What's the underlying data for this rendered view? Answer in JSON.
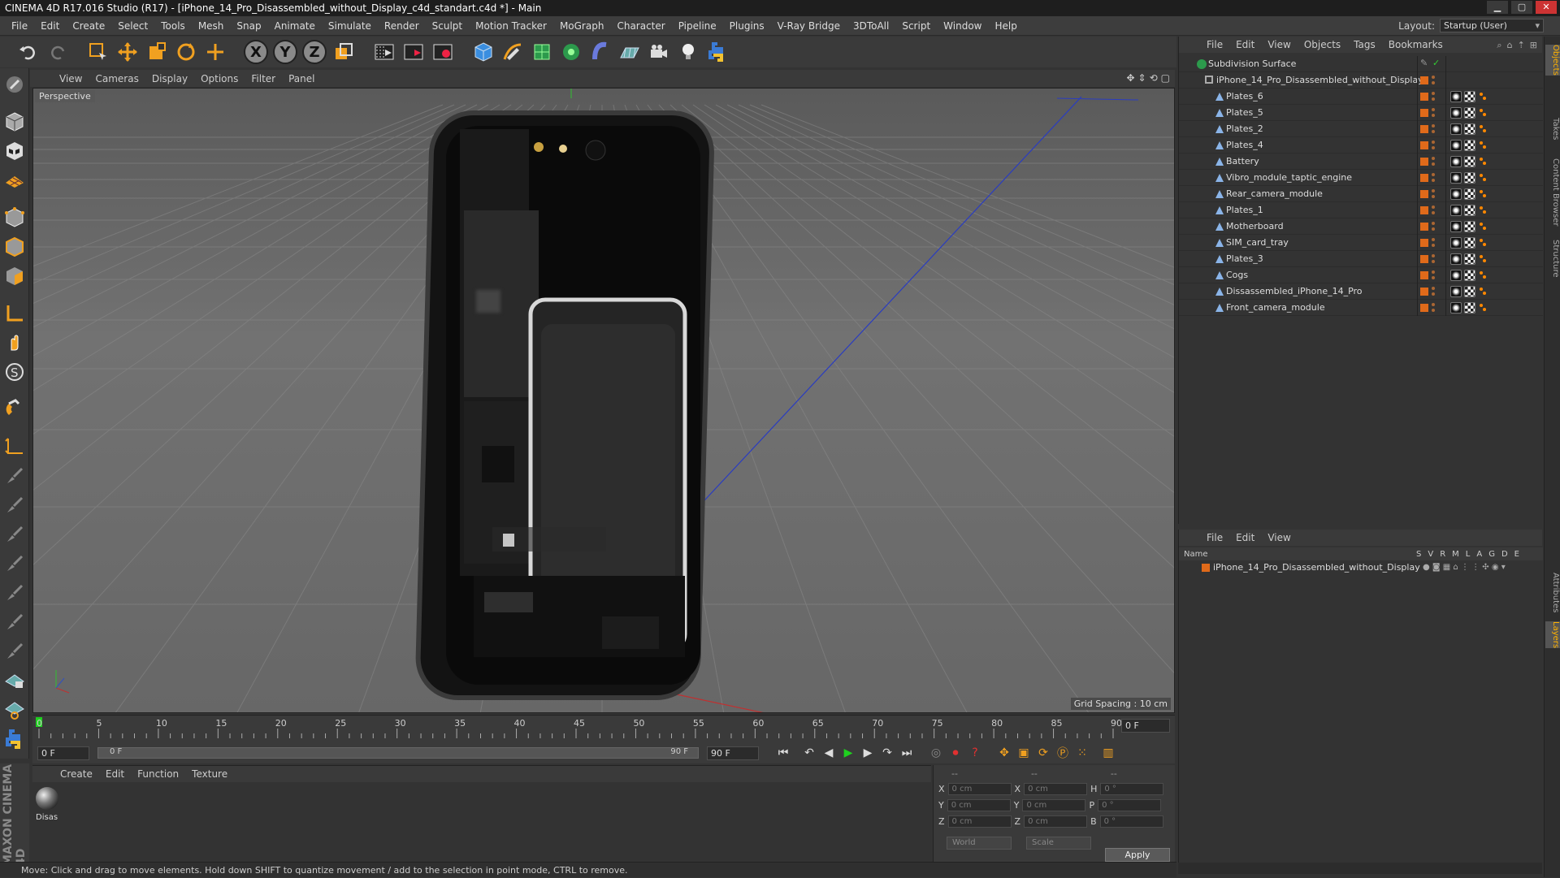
{
  "window": {
    "title": "CINEMA 4D R17.016 Studio (R17) - [iPhone_14_Pro_Disassembled_without_Display_c4d_standart.c4d *] - Main",
    "min": "▁",
    "max": "▢",
    "close": "✕"
  },
  "menubar": [
    "File",
    "Edit",
    "Create",
    "Select",
    "Tools",
    "Mesh",
    "Snap",
    "Animate",
    "Simulate",
    "Render",
    "Sculpt",
    "Motion Tracker",
    "MoGraph",
    "Character",
    "Pipeline",
    "Plugins",
    "V-Ray Bridge",
    "3DToAll",
    "Script",
    "Window",
    "Help"
  ],
  "layout": {
    "label": "Layout:",
    "value": "Startup (User)"
  },
  "toolbar_axes": [
    "X",
    "Y",
    "Z"
  ],
  "viewport": {
    "menu": [
      "View",
      "Cameras",
      "Display",
      "Options",
      "Filter",
      "Panel"
    ],
    "camera": "Perspective",
    "grid_spacing": "Grid Spacing : 10 cm"
  },
  "timeline": {
    "ticks": [
      "0",
      "5",
      "10",
      "15",
      "20",
      "25",
      "30",
      "35",
      "40",
      "45",
      "50",
      "55",
      "60",
      "65",
      "70",
      "75",
      "80",
      "85",
      "90"
    ],
    "current_frame": "0 F",
    "start": "0 F",
    "range_start": "0 F",
    "range_end": "90 F",
    "end": "90 F"
  },
  "material_manager": {
    "menu": [
      "Create",
      "Edit",
      "Function",
      "Texture"
    ],
    "material_name": "Disas"
  },
  "coords": {
    "headers": [
      "--",
      "--",
      "--"
    ],
    "rows": [
      {
        "a": "X",
        "av": "0 cm",
        "b": "X",
        "bv": "0 cm",
        "c": "H",
        "cv": "0 °"
      },
      {
        "a": "Y",
        "av": "0 cm",
        "b": "Y",
        "bv": "0 cm",
        "c": "P",
        "cv": "0 °"
      },
      {
        "a": "Z",
        "av": "0 cm",
        "b": "Z",
        "bv": "0 cm",
        "c": "B",
        "cv": "0 °"
      }
    ],
    "mode1": "World",
    "mode2": "Scale",
    "apply": "Apply"
  },
  "status": "Move: Click and drag to move elements. Hold down SHIFT to quantize movement / add to the selection in point mode, CTRL to remove.",
  "brand": "MAXON CINEMA 4D",
  "object_manager": {
    "menu": [
      "File",
      "Edit",
      "View",
      "Objects",
      "Tags",
      "Bookmarks"
    ],
    "root": "Subdivision Surface",
    "group": "iPhone_14_Pro_Disassembled_without_Display",
    "children": [
      "Plates_6",
      "Plates_5",
      "Plates_2",
      "Plates_4",
      "Battery",
      "Vibro_module_taptic_engine",
      "Rear_camera_module",
      "Plates_1",
      "Motherboard",
      "SIM_card_tray",
      "Plates_3",
      "Cogs",
      "Dissassembled_iPhone_14_Pro",
      "Front_camera_module"
    ]
  },
  "layer_manager": {
    "menu": [
      "File",
      "Edit",
      "View"
    ],
    "name_header": "Name",
    "col_headers": [
      "S",
      "V",
      "R",
      "M",
      "L",
      "A",
      "G",
      "D",
      "E"
    ],
    "layer": "iPhone_14_Pro_Disassembled_without_Display"
  },
  "right_tabs": [
    "Objects",
    "Takes",
    "Content Browser",
    "Structure",
    "Attributes",
    "Layers"
  ],
  "colors": {
    "accent": "#e06a1a",
    "axis_x": "#cc3333",
    "axis_y": "#33cc33",
    "axis_z": "#3355cc",
    "tool_orange": "#f0a020"
  }
}
